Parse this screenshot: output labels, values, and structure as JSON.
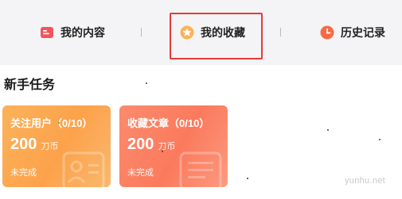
{
  "tabs": [
    {
      "label": "我的内容",
      "icon": "bookmark-icon",
      "color": "#f2545b"
    },
    {
      "label": "我的收藏",
      "icon": "star-icon",
      "color": "#fba24b"
    },
    {
      "label": "历史记录",
      "icon": "clock-icon",
      "color": "#f86a45"
    }
  ],
  "section": {
    "title": "新手任务"
  },
  "tasks": [
    {
      "title": "关注用户（0/10）",
      "amount": "200",
      "unit": "刀币",
      "status": "未完成"
    },
    {
      "title": "收藏文章（0/10）",
      "amount": "200",
      "unit": "刀币",
      "status": "未完成"
    }
  ],
  "watermark": "yunhu.net",
  "colors": {
    "highlight": "#e53a3a",
    "tab_bg": "#f4f4f6"
  }
}
